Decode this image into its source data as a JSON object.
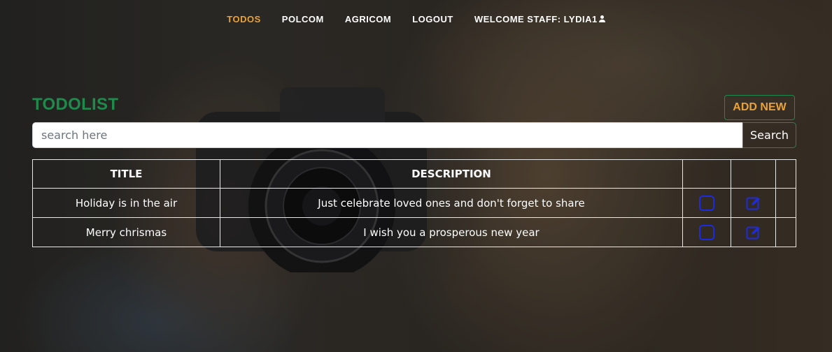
{
  "nav": {
    "items": [
      {
        "label": "TODOS",
        "active": true
      },
      {
        "label": "POLCOM",
        "active": false
      },
      {
        "label": "AGRICOM",
        "active": false
      },
      {
        "label": "LOGOUT",
        "active": false
      },
      {
        "label": "WELCOME STAFF: LYDIA1",
        "active": false,
        "icon": "user-icon"
      }
    ]
  },
  "header": {
    "title": "TODOLIST",
    "add_label": "ADD NEW"
  },
  "search": {
    "placeholder": "search here",
    "value": "",
    "button_label": "Search"
  },
  "table": {
    "headers": [
      "TITLE",
      "DESCRIPTION",
      "",
      "",
      ""
    ],
    "rows": [
      {
        "title": "Holiday is in the air",
        "description": "Just celebrate loved ones and don't forget to share",
        "check_icon": "checkbox-icon",
        "edit_icon": "edit-icon"
      },
      {
        "title": "Merry chrismas",
        "description": "I wish you a prosperous new year",
        "check_icon": "checkbox-icon",
        "edit_icon": "edit-icon"
      }
    ]
  },
  "colors": {
    "accent_orange": "#e9a23a",
    "accent_green": "#1f8a4c",
    "icon_blue": "#1d2be0"
  }
}
